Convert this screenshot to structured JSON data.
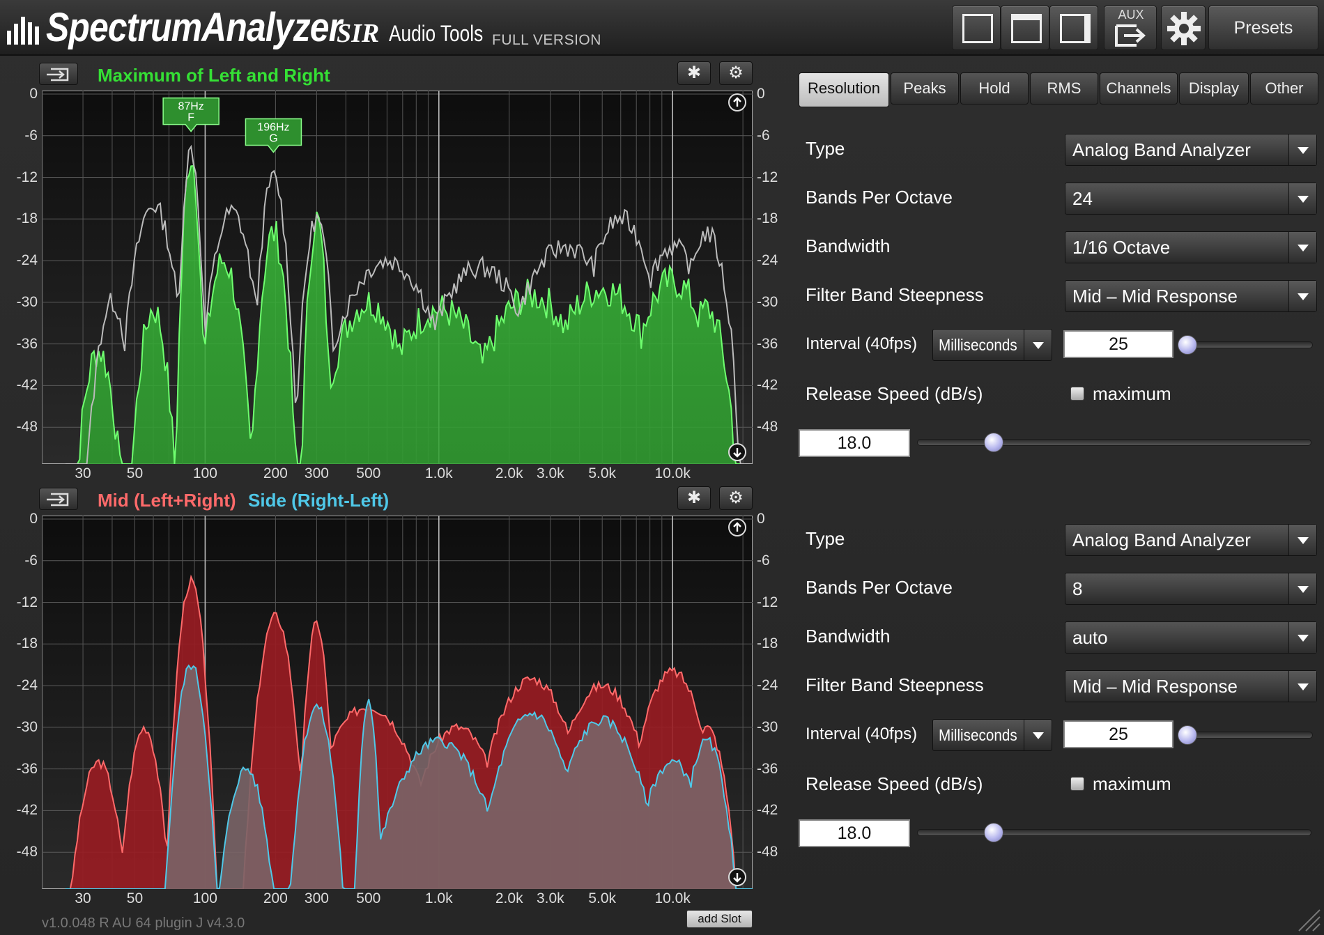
{
  "header": {
    "app_title": "SpectrumAnalyzer",
    "brand": "SIR",
    "brand_sub": "Audio Tools",
    "edition": "FULL VERSION",
    "aux_label": "AUX",
    "presets_label": "Presets"
  },
  "top_panel": {
    "title": "Maximum of Left and Right",
    "title_color": "#35e035",
    "fill_color": "#2f9f2f",
    "peak_markers": [
      {
        "freq": "87Hz",
        "note": "F"
      },
      {
        "freq": "196Hz",
        "note": "G"
      }
    ]
  },
  "bottom_panel": {
    "title_mid": "Mid (Left+Right)",
    "title_side": "Side (Right-Left)",
    "mid_color": "#ff6a6a",
    "side_color": "#4fc8e8"
  },
  "axes": {
    "y_ticks": [
      "0",
      "-6",
      "-12",
      "-18",
      "-24",
      "-30",
      "-36",
      "-42",
      "-48"
    ],
    "x_ticks": [
      "30",
      "50",
      "100",
      "200",
      "300",
      "500",
      "1.0k",
      "2.0k",
      "3.0k",
      "5.0k",
      "10.0k"
    ]
  },
  "tabs": [
    "Resolution",
    "Peaks",
    "Hold",
    "RMS",
    "Channels",
    "Display",
    "Other"
  ],
  "settings_top": {
    "type_label": "Type",
    "type_value": "Analog Band Analyzer",
    "bands_label": "Bands Per Octave",
    "bands_value": "24",
    "bandwidth_label": "Bandwidth",
    "bandwidth_value": "1/16 Octave",
    "steepness_label": "Filter Band Steepness",
    "steepness_value": "Mid – Mid Response",
    "interval_label": "Interval (40fps)",
    "interval_unit": "Milliseconds",
    "interval_value": "25",
    "release_label": "Release Speed (dB/s)",
    "release_checkbox_label": "maximum",
    "release_value": "18.0"
  },
  "settings_bottom": {
    "type_label": "Type",
    "type_value": "Analog Band Analyzer",
    "bands_label": "Bands Per Octave",
    "bands_value": "8",
    "bandwidth_label": "Bandwidth",
    "bandwidth_value": "auto",
    "steepness_label": "Filter Band Steepness",
    "steepness_value": "Mid – Mid Response",
    "interval_label": "Interval (40fps)",
    "interval_unit": "Milliseconds",
    "interval_value": "25",
    "release_label": "Release Speed (dB/s)",
    "release_checkbox_label": "maximum",
    "release_value": "18.0"
  },
  "footer": {
    "version": "v1.0.048 R AU 64  plugin J v4.3.0",
    "add_slot_label": "add Slot"
  }
}
